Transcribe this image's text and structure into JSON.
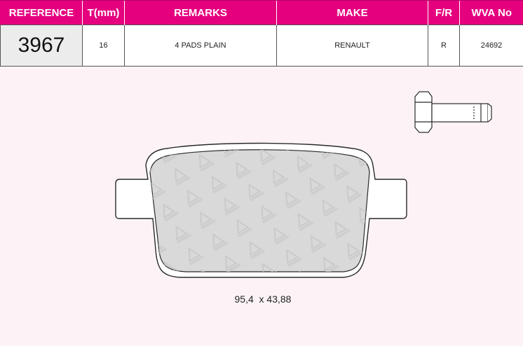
{
  "table": {
    "headers": {
      "reference": "REFERENCE",
      "thickness": "T(mm)",
      "remarks": "REMARKS",
      "make": "MAKE",
      "fr": "F/R",
      "wva": "WVA No"
    },
    "row": {
      "reference": "3967",
      "thickness": "16",
      "remarks": "4 PADS PLAIN",
      "make": "RENAULT",
      "fr": "R",
      "wva": "24692"
    }
  },
  "drawing": {
    "dimensions": "95,4  x 43,88",
    "watermark_icon": "brake-logo-watermark",
    "bolt_icon": "bolt-icon"
  },
  "colors": {
    "header_bg": "#e5007e",
    "page_bg": "#fdf3f6",
    "pad_fill": "#d9d9d9"
  }
}
